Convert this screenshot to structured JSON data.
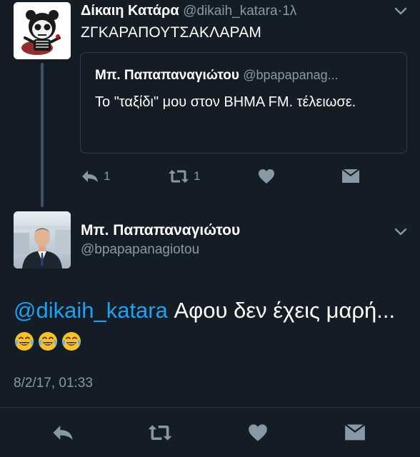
{
  "tweet1": {
    "display_name": "Δίκαιη Κατάρα",
    "handle": "@dikaih_katara",
    "separator": "·",
    "time": "1λ",
    "text": "ΖΓΚΑΡΑΠΟΥΤΣΑΚΛΑΡΑΜ",
    "avatar_icon": "panda-skull-avatar",
    "quoted": {
      "display_name": "Μπ. Παπαπαναγιώτου",
      "handle": "@bpapapanag...",
      "text": "Το \"ταξίδι\" μου στον ΒΗΜΑ FM. τέλειωσε."
    },
    "actions": {
      "reply_count": "1",
      "retweet_count": "1"
    }
  },
  "tweet2": {
    "display_name": "Μπ. Παπαπαναγιώτου",
    "handle": "@bpapapanagiotou",
    "mention": "@dikaih_katara",
    "text": " Αφου δεν έχεις μαρή...",
    "emojis": [
      "face-with-tears-of-joy",
      "face-with-tears-of-joy",
      "face-with-tears-of-joy"
    ],
    "timestamp": "8/2/17, 01:33"
  },
  "colors": {
    "background": "#141d26",
    "text": "#ffffff",
    "secondary": "#8899a6",
    "link": "#1da1f2",
    "border": "#2e3c4a"
  }
}
